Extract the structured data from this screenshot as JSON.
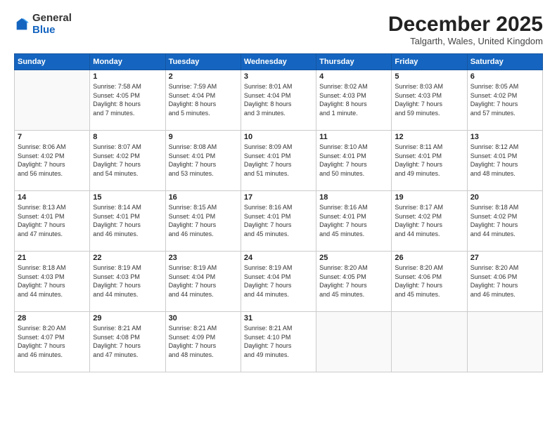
{
  "header": {
    "logo_general": "General",
    "logo_blue": "Blue",
    "month_title": "December 2025",
    "location": "Talgarth, Wales, United Kingdom"
  },
  "days_of_week": [
    "Sunday",
    "Monday",
    "Tuesday",
    "Wednesday",
    "Thursday",
    "Friday",
    "Saturday"
  ],
  "weeks": [
    [
      {
        "day": "",
        "info": ""
      },
      {
        "day": "1",
        "info": "Sunrise: 7:58 AM\nSunset: 4:05 PM\nDaylight: 8 hours\nand 7 minutes."
      },
      {
        "day": "2",
        "info": "Sunrise: 7:59 AM\nSunset: 4:04 PM\nDaylight: 8 hours\nand 5 minutes."
      },
      {
        "day": "3",
        "info": "Sunrise: 8:01 AM\nSunset: 4:04 PM\nDaylight: 8 hours\nand 3 minutes."
      },
      {
        "day": "4",
        "info": "Sunrise: 8:02 AM\nSunset: 4:03 PM\nDaylight: 8 hours\nand 1 minute."
      },
      {
        "day": "5",
        "info": "Sunrise: 8:03 AM\nSunset: 4:03 PM\nDaylight: 7 hours\nand 59 minutes."
      },
      {
        "day": "6",
        "info": "Sunrise: 8:05 AM\nSunset: 4:02 PM\nDaylight: 7 hours\nand 57 minutes."
      }
    ],
    [
      {
        "day": "7",
        "info": "Sunrise: 8:06 AM\nSunset: 4:02 PM\nDaylight: 7 hours\nand 56 minutes."
      },
      {
        "day": "8",
        "info": "Sunrise: 8:07 AM\nSunset: 4:02 PM\nDaylight: 7 hours\nand 54 minutes."
      },
      {
        "day": "9",
        "info": "Sunrise: 8:08 AM\nSunset: 4:01 PM\nDaylight: 7 hours\nand 53 minutes."
      },
      {
        "day": "10",
        "info": "Sunrise: 8:09 AM\nSunset: 4:01 PM\nDaylight: 7 hours\nand 51 minutes."
      },
      {
        "day": "11",
        "info": "Sunrise: 8:10 AM\nSunset: 4:01 PM\nDaylight: 7 hours\nand 50 minutes."
      },
      {
        "day": "12",
        "info": "Sunrise: 8:11 AM\nSunset: 4:01 PM\nDaylight: 7 hours\nand 49 minutes."
      },
      {
        "day": "13",
        "info": "Sunrise: 8:12 AM\nSunset: 4:01 PM\nDaylight: 7 hours\nand 48 minutes."
      }
    ],
    [
      {
        "day": "14",
        "info": "Sunrise: 8:13 AM\nSunset: 4:01 PM\nDaylight: 7 hours\nand 47 minutes."
      },
      {
        "day": "15",
        "info": "Sunrise: 8:14 AM\nSunset: 4:01 PM\nDaylight: 7 hours\nand 46 minutes."
      },
      {
        "day": "16",
        "info": "Sunrise: 8:15 AM\nSunset: 4:01 PM\nDaylight: 7 hours\nand 46 minutes."
      },
      {
        "day": "17",
        "info": "Sunrise: 8:16 AM\nSunset: 4:01 PM\nDaylight: 7 hours\nand 45 minutes."
      },
      {
        "day": "18",
        "info": "Sunrise: 8:16 AM\nSunset: 4:01 PM\nDaylight: 7 hours\nand 45 minutes."
      },
      {
        "day": "19",
        "info": "Sunrise: 8:17 AM\nSunset: 4:02 PM\nDaylight: 7 hours\nand 44 minutes."
      },
      {
        "day": "20",
        "info": "Sunrise: 8:18 AM\nSunset: 4:02 PM\nDaylight: 7 hours\nand 44 minutes."
      }
    ],
    [
      {
        "day": "21",
        "info": "Sunrise: 8:18 AM\nSunset: 4:03 PM\nDaylight: 7 hours\nand 44 minutes."
      },
      {
        "day": "22",
        "info": "Sunrise: 8:19 AM\nSunset: 4:03 PM\nDaylight: 7 hours\nand 44 minutes."
      },
      {
        "day": "23",
        "info": "Sunrise: 8:19 AM\nSunset: 4:04 PM\nDaylight: 7 hours\nand 44 minutes."
      },
      {
        "day": "24",
        "info": "Sunrise: 8:19 AM\nSunset: 4:04 PM\nDaylight: 7 hours\nand 44 minutes."
      },
      {
        "day": "25",
        "info": "Sunrise: 8:20 AM\nSunset: 4:05 PM\nDaylight: 7 hours\nand 45 minutes."
      },
      {
        "day": "26",
        "info": "Sunrise: 8:20 AM\nSunset: 4:06 PM\nDaylight: 7 hours\nand 45 minutes."
      },
      {
        "day": "27",
        "info": "Sunrise: 8:20 AM\nSunset: 4:06 PM\nDaylight: 7 hours\nand 46 minutes."
      }
    ],
    [
      {
        "day": "28",
        "info": "Sunrise: 8:20 AM\nSunset: 4:07 PM\nDaylight: 7 hours\nand 46 minutes."
      },
      {
        "day": "29",
        "info": "Sunrise: 8:21 AM\nSunset: 4:08 PM\nDaylight: 7 hours\nand 47 minutes."
      },
      {
        "day": "30",
        "info": "Sunrise: 8:21 AM\nSunset: 4:09 PM\nDaylight: 7 hours\nand 48 minutes."
      },
      {
        "day": "31",
        "info": "Sunrise: 8:21 AM\nSunset: 4:10 PM\nDaylight: 7 hours\nand 49 minutes."
      },
      {
        "day": "",
        "info": ""
      },
      {
        "day": "",
        "info": ""
      },
      {
        "day": "",
        "info": ""
      }
    ]
  ]
}
